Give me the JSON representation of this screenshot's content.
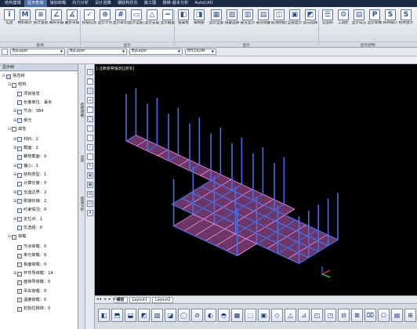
{
  "tabs": [
    "结构建模",
    "显示查询",
    "施加荷载",
    "内力分析",
    "设计验算",
    "钢结构优化",
    "施工图",
    "楼梯-基本分析",
    "AutoCAD"
  ],
  "active_tab": 1,
  "ribbon": {
    "buttons": [
      {
        "icon": "info-icon",
        "glyph": "i",
        "label": "信息"
      },
      {
        "icon": "mat-icon",
        "glyph": "M",
        "label": "材料统计"
      },
      {
        "icon": "stat-icon",
        "glyph": "≡",
        "label": "统计查询"
      },
      {
        "icon": "angle-icon",
        "glyph": "∠",
        "label": "两杆夹角"
      },
      {
        "icon": "angle3-icon",
        "glyph": "∡",
        "label": "叠步夹角"
      },
      {
        "icon": "check-icon",
        "glyph": "✓",
        "label": "校核信息"
      },
      {
        "icon": "node-icon",
        "glyph": "⊕",
        "label": "显示节点"
      },
      {
        "icon": "elem-icon",
        "glyph": "#",
        "label": "显示单元编号"
      },
      {
        "icon": "sect-icon",
        "glyph": "▭",
        "label": "显示全部支座编号"
      },
      {
        "icon": "support-icon",
        "glyph": "△",
        "label": "显示支座"
      },
      {
        "icon": "beam-icon",
        "glyph": "═",
        "label": "显示截面"
      },
      {
        "icon": "attr-icon",
        "glyph": "◧",
        "label": "按属性"
      },
      {
        "icon": "mat2-icon",
        "glyph": "◨",
        "label": "按材质"
      },
      {
        "icon": "showall-icon",
        "glyph": "▦",
        "label": "显示全部"
      },
      {
        "icon": "hide-icon",
        "glyph": "▨",
        "label": "隐藏选择"
      },
      {
        "icon": "partshow-icon",
        "glyph": "▥",
        "label": "部分显示"
      },
      {
        "icon": "parthide-icon",
        "glyph": "▤",
        "label": "部分隐藏"
      },
      {
        "icon": "unfix-icon",
        "glyph": "◫",
        "label": "取消附加信息"
      },
      {
        "icon": "all-icon",
        "glyph": "▣",
        "label": "全部显示"
      },
      {
        "icon": "invert-icon",
        "glyph": "◩",
        "label": "反向选择"
      },
      {
        "icon": "tree-icon",
        "glyph": "☰",
        "label": "信息树"
      },
      {
        "icon": "gear-icon",
        "glyph": "⚙",
        "label": "工具栏"
      },
      {
        "icon": "log-icon",
        "glyph": "▤",
        "label": "显示日志"
      },
      {
        "icon": "param-icon",
        "glyph": "P",
        "label": "显示参数"
      },
      {
        "icon": "shrink-icon",
        "glyph": "S",
        "label": "构件缩小"
      },
      {
        "icon": "expand-icon",
        "glyph": "S",
        "label": "构件放大"
      },
      {
        "icon": "restore-icon",
        "glyph": "S",
        "label": "恢复默认"
      }
    ],
    "groups": [
      "查询",
      "显示",
      "显示",
      "显示控制"
    ]
  },
  "layer_bar": {
    "layer": "ByLayer",
    "linetype": "ByLayer",
    "lineweight": "ByLayer",
    "color": "BYCOLOR"
  },
  "panel": {
    "title": "显示树",
    "nodes": [
      {
        "level": 0,
        "toggle": "⊟",
        "icon": "m",
        "text": "信息树"
      },
      {
        "level": 1,
        "toggle": "⊟",
        "icon": "",
        "text": "结构"
      },
      {
        "level": 2,
        "toggle": "",
        "icon": "",
        "text": "项目信息"
      },
      {
        "level": 2,
        "toggle": "",
        "icon": "",
        "text": "长度单位：毫米"
      },
      {
        "level": 2,
        "toggle": "⊞",
        "icon": "",
        "text": "节点：384"
      },
      {
        "level": 2,
        "toggle": "⊞",
        "icon": "",
        "text": "单元"
      },
      {
        "level": 1,
        "toggle": "⊟",
        "icon": "",
        "text": "属性"
      },
      {
        "level": 2,
        "toggle": "⊞",
        "icon": "",
        "text": "材料：2"
      },
      {
        "level": 2,
        "toggle": "⊞",
        "icon": "",
        "text": "截面：2"
      },
      {
        "level": 2,
        "toggle": "",
        "icon": "",
        "text": "螺栓截面：0"
      },
      {
        "level": 2,
        "toggle": "⊞",
        "icon": "",
        "text": "偏心：1"
      },
      {
        "level": 2,
        "toggle": "⊞",
        "icon": "",
        "text": "结构类型：1"
      },
      {
        "level": 2,
        "toggle": "",
        "icon": "",
        "text": "计算长度：0"
      },
      {
        "level": 2,
        "toggle": "⊞",
        "icon": "",
        "text": "支座边界：2"
      },
      {
        "level": 2,
        "toggle": "⊞",
        "icon": "",
        "text": "刚接铰接：2"
      },
      {
        "level": 2,
        "toggle": "",
        "icon": "",
        "text": "约束情况：0"
      },
      {
        "level": 2,
        "toggle": "⊞",
        "icon": "",
        "text": "定位点：1"
      },
      {
        "level": 2,
        "toggle": "",
        "icon": "",
        "text": "优选组：0"
      },
      {
        "level": 1,
        "toggle": "⊟",
        "icon": "l",
        "text": "荷载"
      },
      {
        "level": 2,
        "toggle": "",
        "icon": "l",
        "text": "节点荷载：0"
      },
      {
        "level": 2,
        "toggle": "",
        "icon": "l",
        "text": "单元荷载：0"
      },
      {
        "level": 2,
        "toggle": "",
        "icon": "l",
        "text": "板面荷载：0"
      },
      {
        "level": 2,
        "toggle": "⊞",
        "icon": "l",
        "text": "杆件导荷载：14"
      },
      {
        "level": 2,
        "toggle": "",
        "icon": "l",
        "text": "面荷导荷载：0"
      },
      {
        "level": 2,
        "toggle": "",
        "icon": "l",
        "text": "吊车荷载：0"
      },
      {
        "level": 2,
        "toggle": "",
        "icon": "l",
        "text": "温度荷载：0"
      },
      {
        "level": 2,
        "toggle": "",
        "icon": "l",
        "text": "初始位移荷：0"
      }
    ]
  },
  "side_tabs": [
    "结构建模",
    "显示",
    "荷载分析"
  ],
  "viewport": {
    "label": "[-][西南等轴测][真实]"
  },
  "layout_tabs": {
    "nav": "◂◂ ◂ ▸ ▸▸",
    "items": [
      "模型",
      "Layout1",
      "Layout2"
    ]
  },
  "colors": {
    "beam": "#c277c7",
    "slab": "#ff8df0",
    "column": "#4b6de0",
    "bg": "#000000"
  }
}
